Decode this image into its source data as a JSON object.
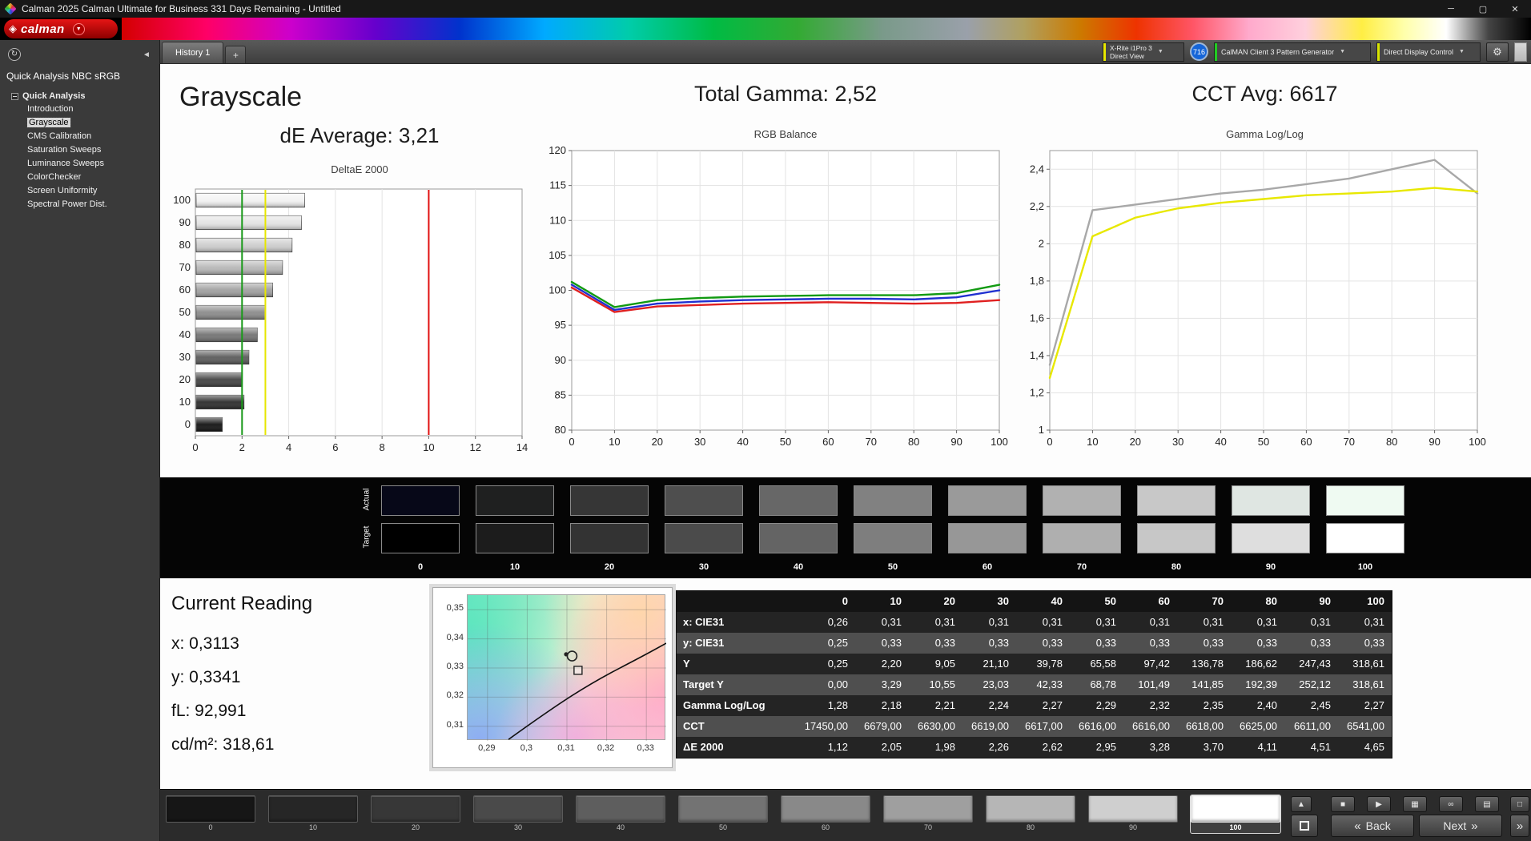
{
  "window": {
    "title": "Calman 2025 Calman Ultimate for Business 331 Days Remaining  - Untitled"
  },
  "icons": {
    "minimize": "─",
    "maximize": "▢",
    "close": "✕",
    "logo_diamond": "◈",
    "dropdown": "▼",
    "collapse_left": "◄",
    "refresh": "↻",
    "gear": "⚙",
    "add_tab": "+",
    "up": "▲",
    "stop": "■",
    "play": "▶",
    "save": "▦",
    "link": "∞",
    "grid": "▤",
    "window": "□",
    "back": "«",
    "next": "»"
  },
  "logo": {
    "text": "calman"
  },
  "tabs": {
    "active": "History 1",
    "add": "+"
  },
  "toolbar": {
    "meter": {
      "line1": "X-Rite i1Pro 3",
      "line2": "Direct View",
      "accent": "#e8e800"
    },
    "badge": "716",
    "pattern_generator": {
      "label": "CalMAN Client 3 Pattern Generator",
      "accent": "#22cc22"
    },
    "display_control": {
      "label": "Direct Display Control",
      "accent": "#d8e400"
    }
  },
  "sidebar": {
    "header": "Quick Analysis NBC sRGB",
    "group": "Quick Analysis",
    "items": [
      "Introduction",
      "Grayscale",
      "CMS Calibration",
      "Saturation Sweeps",
      "Luminance Sweeps",
      "ColorChecker",
      "Screen Uniformity",
      "Spectral Power Dist."
    ],
    "selected": "Grayscale"
  },
  "headers": {
    "page_title": "Grayscale",
    "de_average": "dE Average: 3,21",
    "total_gamma": "Total Gamma: 2,52",
    "cct_avg": "CCT Avg: 6617"
  },
  "chart_data": [
    {
      "id": "deltae2000",
      "type": "bar",
      "orientation": "horizontal",
      "title": "DeltaE 2000",
      "categories": [
        100,
        90,
        80,
        70,
        60,
        50,
        40,
        30,
        20,
        10,
        0
      ],
      "values": [
        4.65,
        4.51,
        4.11,
        3.7,
        3.28,
        2.95,
        2.62,
        2.26,
        1.98,
        2.05,
        1.12
      ],
      "bar_colors": [
        "#f2f2f2",
        "#e3e3e3",
        "#cdcdcd",
        "#b7b7b7",
        "#a0a0a0",
        "#8a8a8a",
        "#737373",
        "#5a5a5a",
        "#424242",
        "#2b2b2b",
        "#111111"
      ],
      "xlim": [
        0,
        14
      ],
      "xticks": [
        0,
        2,
        4,
        6,
        8,
        10,
        12,
        14
      ],
      "ref_lines": [
        {
          "x": 2,
          "color": "#1a9a1a"
        },
        {
          "x": 3,
          "color": "#e6e600"
        },
        {
          "x": 10,
          "color": "#e01010"
        }
      ]
    },
    {
      "id": "rgb_balance",
      "type": "line",
      "title": "RGB Balance",
      "x": [
        0,
        10,
        20,
        30,
        40,
        50,
        60,
        70,
        80,
        90,
        100
      ],
      "ylim": [
        80,
        120
      ],
      "yticks": [
        80,
        85,
        90,
        95,
        100,
        105,
        110,
        115,
        120
      ],
      "ytick_labels": [
        "80",
        "85",
        "90",
        "95",
        "100",
        "105",
        "110",
        "115",
        "120"
      ],
      "series": [
        {
          "name": "Red",
          "color": "#e02020",
          "values": [
            100.4,
            96.9,
            97.7,
            97.9,
            98.1,
            98.2,
            98.3,
            98.2,
            98.1,
            98.2,
            98.6
          ]
        },
        {
          "name": "Blue",
          "color": "#2030d0",
          "values": [
            100.8,
            97.2,
            98.1,
            98.4,
            98.6,
            98.7,
            98.8,
            98.8,
            98.7,
            99.0,
            100.0
          ]
        },
        {
          "name": "Green",
          "color": "#129a12",
          "values": [
            101.2,
            97.6,
            98.6,
            98.9,
            99.1,
            99.2,
            99.3,
            99.3,
            99.3,
            99.6,
            100.8
          ]
        }
      ]
    },
    {
      "id": "gamma_loglog",
      "type": "line",
      "title": "Gamma Log/Log",
      "x": [
        0,
        10,
        20,
        30,
        40,
        50,
        60,
        70,
        80,
        90,
        100
      ],
      "ylim": [
        1.0,
        2.5
      ],
      "yticks": [
        1,
        1.2,
        1.4,
        1.6,
        1.8,
        2,
        2.2,
        2.4
      ],
      "ytick_labels": [
        "1",
        "1,2",
        "1,4",
        "1,6",
        "1,8",
        "2",
        "2,2",
        "2,4"
      ],
      "series": [
        {
          "name": "Gray",
          "color": "#a8a8a8",
          "values": [
            1.35,
            2.18,
            2.21,
            2.24,
            2.27,
            2.29,
            2.32,
            2.35,
            2.4,
            2.45,
            2.27
          ]
        },
        {
          "name": "Yellow",
          "color": "#e8e800",
          "values": [
            1.28,
            2.04,
            2.14,
            2.19,
            2.22,
            2.24,
            2.26,
            2.27,
            2.28,
            2.3,
            2.28
          ]
        }
      ]
    },
    {
      "id": "cie_xy",
      "type": "scatter",
      "xlim": [
        0.285,
        0.335
      ],
      "ylim": [
        0.305,
        0.355
      ],
      "xticks": [
        "0,29",
        "0,3",
        "0,31",
        "0,32",
        "0,33"
      ],
      "yticks": [
        "0,35",
        "0,34",
        "0,33",
        "0,32",
        "0,31"
      ],
      "xtick_vals": [
        0.29,
        0.3,
        0.31,
        0.32,
        0.33
      ],
      "ytick_vals": [
        0.35,
        0.34,
        0.33,
        0.32,
        0.31
      ],
      "locus": [
        [
          0.2953,
          0.3055
        ],
        [
          0.3055,
          0.3155
        ],
        [
          0.317,
          0.3255
        ],
        [
          0.329,
          0.334
        ],
        [
          0.335,
          0.3385
        ]
      ],
      "points": [
        {
          "name": "measured",
          "shape": "circle",
          "x": 0.3113,
          "y": 0.3341
        },
        {
          "name": "measured-dot",
          "shape": "dot",
          "x": 0.3098,
          "y": 0.3347
        },
        {
          "name": "target",
          "shape": "square",
          "x": 0.3128,
          "y": 0.3292
        }
      ]
    }
  ],
  "swatches": {
    "row_labels": [
      "Actual",
      "Target"
    ],
    "labels": [
      "0",
      "10",
      "20",
      "30",
      "40",
      "50",
      "60",
      "70",
      "80",
      "90",
      "100"
    ],
    "actual": [
      "#070818",
      "#1f2020",
      "#363636",
      "#4e4e4e",
      "#676767",
      "#818181",
      "#9a9a9a",
      "#b1b1b1",
      "#c8c8c8",
      "#dfe6e2",
      "#effaf2"
    ],
    "target": [
      "#000000",
      "#1c1c1c",
      "#333333",
      "#4b4b4b",
      "#646464",
      "#7e7e7e",
      "#979797",
      "#afafaf",
      "#c7c7c7",
      "#dedede",
      "#ffffff"
    ]
  },
  "current_reading": {
    "title": "Current Reading",
    "lines": [
      "x: 0,3113",
      "y: 0,3341",
      "fL: 92,991",
      "cd/m²: 318,61"
    ]
  },
  "table": {
    "columns": [
      "0",
      "10",
      "20",
      "30",
      "40",
      "50",
      "60",
      "70",
      "80",
      "90",
      "100"
    ],
    "rows": [
      {
        "label": "x: CIE31",
        "values": [
          "0,26",
          "0,31",
          "0,31",
          "0,31",
          "0,31",
          "0,31",
          "0,31",
          "0,31",
          "0,31",
          "0,31",
          "0,31"
        ]
      },
      {
        "label": "y: CIE31",
        "values": [
          "0,25",
          "0,33",
          "0,33",
          "0,33",
          "0,33",
          "0,33",
          "0,33",
          "0,33",
          "0,33",
          "0,33",
          "0,33"
        ]
      },
      {
        "label": "Y",
        "values": [
          "0,25",
          "2,20",
          "9,05",
          "21,10",
          "39,78",
          "65,58",
          "97,42",
          "136,78",
          "186,62",
          "247,43",
          "318,61"
        ]
      },
      {
        "label": "Target Y",
        "values": [
          "0,00",
          "3,29",
          "10,55",
          "23,03",
          "42,33",
          "68,78",
          "101,49",
          "141,85",
          "192,39",
          "252,12",
          "318,61"
        ]
      },
      {
        "label": "Gamma Log/Log",
        "values": [
          "1,28",
          "2,18",
          "2,21",
          "2,24",
          "2,27",
          "2,29",
          "2,32",
          "2,35",
          "2,40",
          "2,45",
          "2,27"
        ]
      },
      {
        "label": "CCT",
        "values": [
          "17450,00",
          "6679,00",
          "6630,00",
          "6619,00",
          "6617,00",
          "6616,00",
          "6616,00",
          "6618,00",
          "6625,00",
          "6611,00",
          "6541,00"
        ]
      },
      {
        "label": "ΔE 2000",
        "values": [
          "1,12",
          "2,05",
          "1,98",
          "2,26",
          "2,62",
          "2,95",
          "3,28",
          "3,70",
          "4,11",
          "4,51",
          "4,65"
        ]
      }
    ]
  },
  "bottom": {
    "patterns": [
      {
        "label": "0",
        "color": "#161616"
      },
      {
        "label": "10",
        "color": "#262626"
      },
      {
        "label": "20",
        "color": "#373737"
      },
      {
        "label": "30",
        "color": "#4a4a4a"
      },
      {
        "label": "40",
        "color": "#5e5e5e"
      },
      {
        "label": "50",
        "color": "#737373"
      },
      {
        "label": "60",
        "color": "#898989"
      },
      {
        "label": "70",
        "color": "#9f9f9f"
      },
      {
        "label": "80",
        "color": "#b6b6b6"
      },
      {
        "label": "90",
        "color": "#cfcfcf"
      },
      {
        "label": "100",
        "color": "#ffffff"
      }
    ],
    "selected_index": 10,
    "back_label": "Back",
    "next_label": "Next"
  }
}
